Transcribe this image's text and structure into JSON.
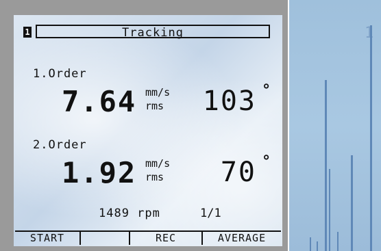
{
  "screen": {
    "page_badge": "1",
    "title": "Tracking",
    "orders": [
      {
        "label": "1.Order",
        "amplitude": "7.64",
        "unit_top": "mm/s",
        "unit_bottom": "rms",
        "phase": "103",
        "phase_symbol": "°"
      },
      {
        "label": "2.Order",
        "amplitude": "1.92",
        "unit_top": "mm/s",
        "unit_bottom": "rms",
        "phase": "70",
        "phase_symbol": "°"
      }
    ],
    "speed": "1489 rpm",
    "page_indicator": "1/1"
  },
  "softkeys": [
    {
      "label": "START"
    },
    {
      "label": ""
    },
    {
      "label": "REC"
    },
    {
      "label": "AVERAGE"
    }
  ],
  "background_panel": {
    "label": "1"
  },
  "colors": {
    "bezel": "#9a9a9a",
    "lcd_background": "#d4e1ee",
    "lcd_text": "#111111",
    "spectrum_background": "#a9c8e2",
    "spectrum_peaks": "#5f88b7"
  }
}
